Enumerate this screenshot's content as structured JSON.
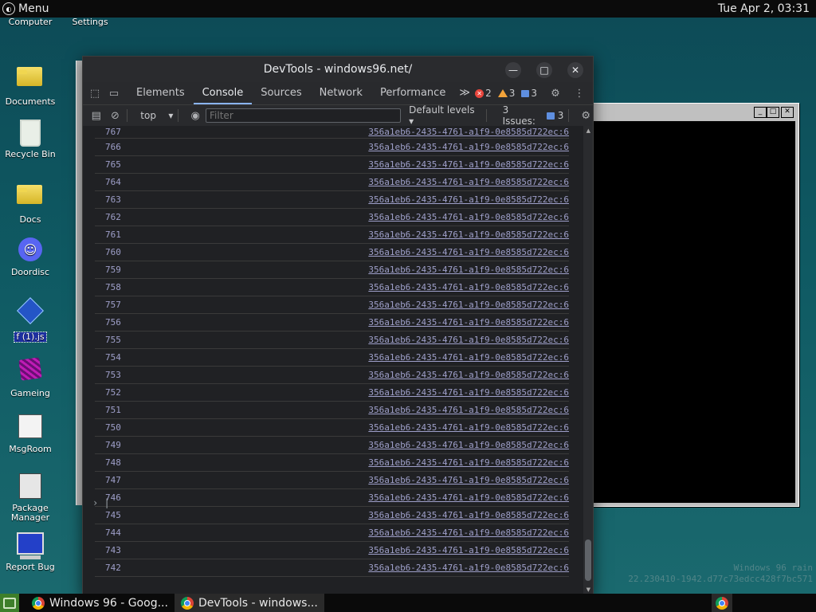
{
  "topbar": {
    "menu_label": "Menu",
    "clock": "Tue Apr 2, 03:31"
  },
  "desktop_icons": [
    {
      "label": "Computer"
    },
    {
      "label": "Settings"
    },
    {
      "label": "Documents"
    },
    {
      "label": "Recycle Bin"
    },
    {
      "label": "Docs"
    },
    {
      "label": "Doordisc"
    },
    {
      "label": "f (1).js"
    },
    {
      "label": "Gameing"
    },
    {
      "label": "MsgRoom"
    },
    {
      "label": "Package Manager"
    },
    {
      "label": "Report Bug"
    }
  ],
  "devtools": {
    "title": "DevTools - windows96.net/",
    "tabs": [
      "Elements",
      "Console",
      "Sources",
      "Network",
      "Performance"
    ],
    "active_tab": "Console",
    "more_tabs": "≫",
    "errors_count": "2",
    "warnings_count": "3",
    "info_count": "3",
    "toolbar": {
      "context": "top",
      "filter_placeholder": "Filter",
      "levels": "Default levels",
      "issues_label": "3 Issues:",
      "issues_count": "3"
    },
    "source_link": "356a1eb6-2435-4761-a1f9-0e8585d722ec:6",
    "log_numbers": [
      "767",
      "766",
      "765",
      "764",
      "763",
      "762",
      "761",
      "760",
      "759",
      "758",
      "757",
      "756",
      "755",
      "754",
      "753",
      "752",
      "751",
      "750",
      "749",
      "748",
      "747",
      "746",
      "745",
      "744",
      "743",
      "742"
    ],
    "prompt": "›"
  },
  "watermark": {
    "line1": "Windows 96 rain",
    "line2": "22.230410-1942.d77c73edcc428f7bc571"
  },
  "taskbar": {
    "tasks": [
      {
        "label": "Windows 96 - Goog..."
      },
      {
        "label": "DevTools - windows..."
      }
    ]
  },
  "colors": {
    "accent": "#8ab4f8",
    "link": "#9e9fc9",
    "desktop": "#0f5a63"
  }
}
